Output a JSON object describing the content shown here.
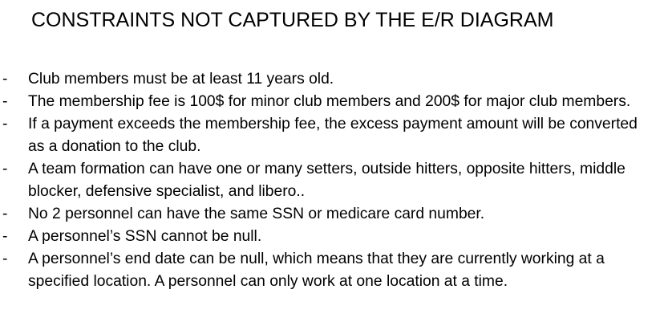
{
  "document": {
    "title": "CONSTRAINTS NOT CAPTURED BY THE E/R DIAGRAM",
    "bullet_marker": "-",
    "constraints": [
      "Club members must be at least 11 years old.",
      "The membership fee is 100$ for minor club members and 200$ for major club members.",
      "If a payment exceeds the membership fee, the excess payment amount will be converted as a donation to the club.",
      "A team formation can have one or many setters, outside hitters, opposite hitters, middle blocker, defensive specialist, and libero..",
      "No 2 personnel can have the same SSN or medicare card number.",
      "A personnel’s SSN cannot be null.",
      "A personnel’s end date can be null, which means that they are currently working at a specified location. A personnel can only work at one location at a time."
    ]
  }
}
